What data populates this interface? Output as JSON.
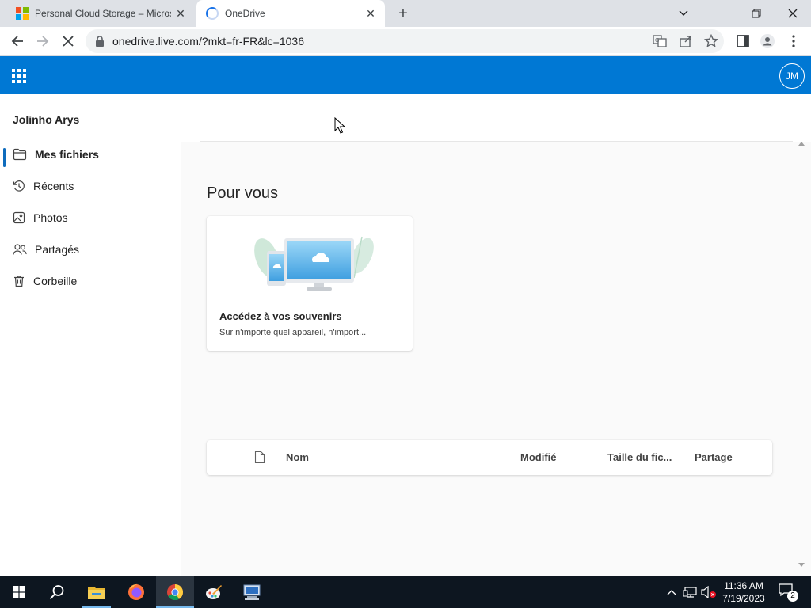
{
  "browser": {
    "tabs": [
      {
        "title": "Personal Cloud Storage – Microsoft",
        "active": false
      },
      {
        "title": "OneDrive",
        "active": true
      }
    ],
    "url": "onedrive.live.com/?mkt=fr-FR&lc=1036"
  },
  "header": {
    "avatar_initials": "JM"
  },
  "sidebar": {
    "user_name": "Jolinho Arys",
    "items": [
      {
        "label": "Mes fichiers",
        "icon": "folder-icon",
        "selected": true
      },
      {
        "label": "Récents",
        "icon": "history-icon",
        "selected": false
      },
      {
        "label": "Photos",
        "icon": "image-icon",
        "selected": false
      },
      {
        "label": "Partagés",
        "icon": "people-icon",
        "selected": false
      },
      {
        "label": "Corbeille",
        "icon": "trash-icon",
        "selected": false
      }
    ]
  },
  "main": {
    "section_title": "Pour vous",
    "card": {
      "title": "Accédez à vos souvenirs",
      "subtitle": "Sur n'importe quel appareil, n'import..."
    },
    "columns": {
      "name": "Nom",
      "modified": "Modifié",
      "size": "Taille du fic...",
      "sharing": "Partage"
    }
  },
  "taskbar": {
    "time": "11:36 AM",
    "date": "7/19/2023",
    "notification_count": "2"
  },
  "colors": {
    "brand": "#0078d4",
    "taskbar": "#0d1620",
    "accent_indicator": "#0f6cbd"
  }
}
